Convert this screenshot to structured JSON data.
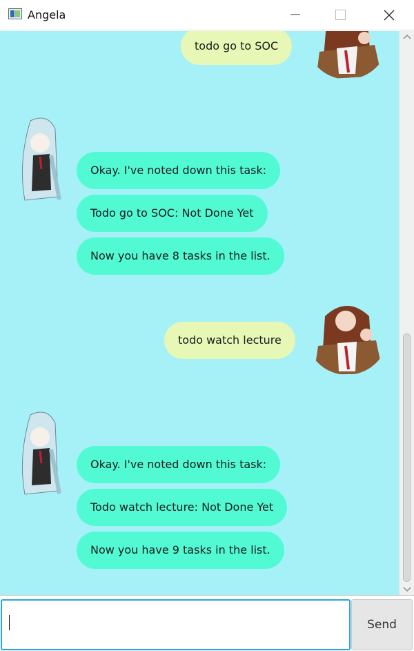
{
  "window": {
    "title": "Angela",
    "icons": {
      "app": "app-window-icon",
      "minimize": "minimize-icon",
      "maximize": "maximize-icon",
      "close": "close-icon"
    }
  },
  "chat": {
    "messages": [
      {
        "sender": "user",
        "text": "todo go to SOC"
      },
      {
        "sender": "bot",
        "text": "Okay. I've noted down this task:"
      },
      {
        "sender": "bot",
        "text": "Todo go to SOC: Not Done Yet"
      },
      {
        "sender": "bot",
        "text": "Now you have 8 tasks in the list."
      },
      {
        "sender": "user",
        "text": "todo watch lecture"
      },
      {
        "sender": "bot",
        "text": "Okay. I've noted down this task:"
      },
      {
        "sender": "bot",
        "text": "Todo watch lecture: Not Done Yet"
      },
      {
        "sender": "bot",
        "text": "Now you have 9 tasks in the list."
      }
    ],
    "avatars": {
      "user": "user-avatar-icon",
      "bot": "bot-avatar-icon"
    }
  },
  "input": {
    "value": "",
    "placeholder": "",
    "send_label": "Send"
  },
  "colors": {
    "chat_background": "#a6f1f8",
    "user_bubble": "#e6f7b6",
    "bot_bubble": "#52fad4",
    "input_border": "#2aa5de"
  }
}
